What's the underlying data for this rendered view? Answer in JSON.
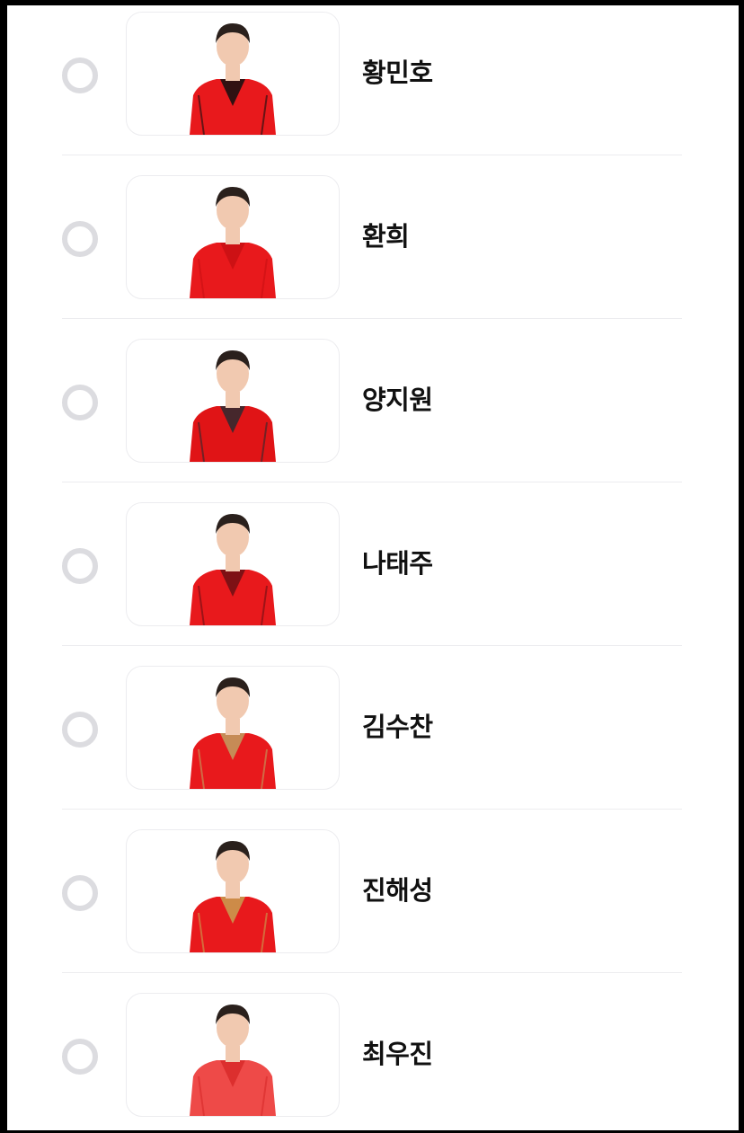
{
  "vote_list": {
    "candidates": [
      {
        "name": "황민호",
        "selected": false,
        "outfit_color": "#e8191c",
        "accent": "#111111"
      },
      {
        "name": "환희",
        "selected": false,
        "outfit_color": "#e8191c",
        "accent": "#c81013"
      },
      {
        "name": "양지원",
        "selected": false,
        "outfit_color": "#e01416",
        "accent": "#2a2a30"
      },
      {
        "name": "나태주",
        "selected": false,
        "outfit_color": "#e8191c",
        "accent": "#6b1014"
      },
      {
        "name": "김수찬",
        "selected": false,
        "outfit_color": "#e8191c",
        "accent": "#c0a060"
      },
      {
        "name": "진해성",
        "selected": false,
        "outfit_color": "#e8191c",
        "accent": "#c8a050"
      },
      {
        "name": "최우진",
        "selected": false,
        "outfit_color": "#ee4a48",
        "accent": "#d82a2a"
      }
    ]
  },
  "colors": {
    "radio_border": "#dcdce0",
    "card_border": "#ececef",
    "divider": "#ececef",
    "name_text": "#111111",
    "skin": "#f1c9b0",
    "hair": "#2a201c"
  }
}
